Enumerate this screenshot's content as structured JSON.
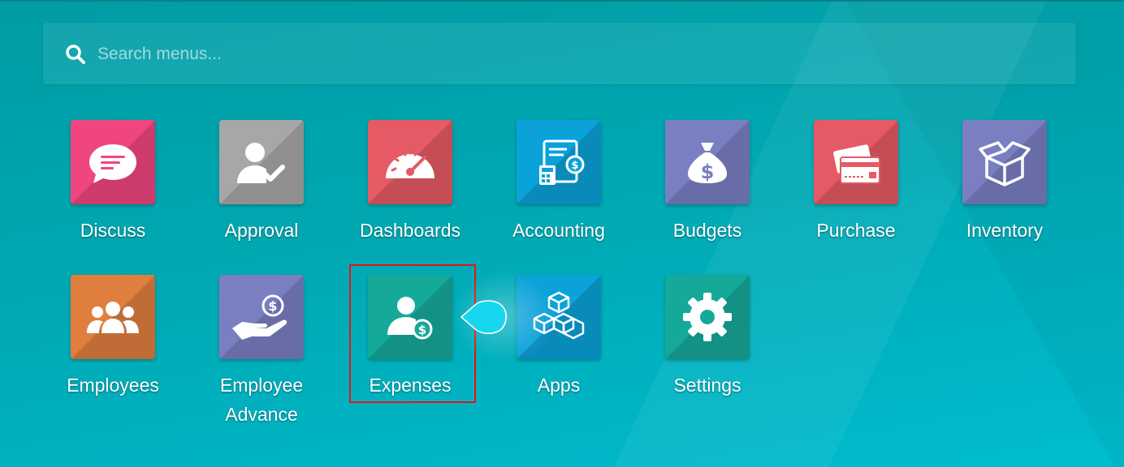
{
  "search": {
    "placeholder": "Search menus..."
  },
  "apps": [
    {
      "label": "Discuss",
      "color": "#f0467f",
      "icon": "chat-bubble-icon"
    },
    {
      "label": "Approval",
      "color": "#a7a7a7",
      "icon": "user-check-icon"
    },
    {
      "label": "Dashboards",
      "color": "#e55a64",
      "icon": "speedometer-icon"
    },
    {
      "label": "Accounting",
      "color": "#0aa2d8",
      "icon": "invoice-calculator-icon"
    },
    {
      "label": "Budgets",
      "color": "#7a7fc2",
      "icon": "money-bag-icon"
    },
    {
      "label": "Purchase",
      "color": "#e55a64",
      "icon": "credit-cards-icon"
    },
    {
      "label": "Inventory",
      "color": "#7a7fc2",
      "icon": "open-box-icon"
    },
    {
      "label": "Employees",
      "color": "#e07e40",
      "icon": "team-icon"
    },
    {
      "label": "Employee\nAdvance",
      "color": "#7a7fc2",
      "icon": "hand-coin-icon"
    },
    {
      "label": "Expenses",
      "color": "#15a99a",
      "icon": "user-dollar-icon"
    },
    {
      "label": "Apps",
      "color": "#0aa2d8",
      "icon": "cubes-icon"
    },
    {
      "label": "Settings",
      "color": "#15a99a",
      "icon": "gear-icon"
    }
  ],
  "highlight": {
    "target": "Expenses",
    "color": "#e0151b"
  }
}
